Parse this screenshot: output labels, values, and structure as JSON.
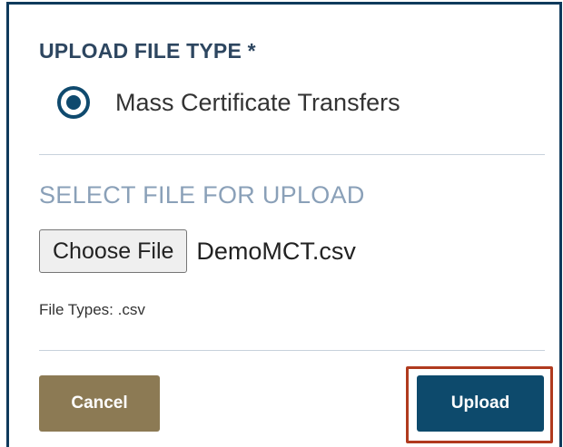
{
  "upload_file_type": {
    "title": "UPLOAD FILE TYPE *",
    "options": [
      {
        "label": "Mass Certificate Transfers",
        "selected": true
      }
    ]
  },
  "file_select": {
    "title": "SELECT FILE FOR UPLOAD",
    "choose_button_label": "Choose File",
    "selected_file_name": "DemoMCT.csv",
    "file_types_hint": "File Types: .csv"
  },
  "actions": {
    "cancel_label": "Cancel",
    "upload_label": "Upload",
    "upload_highlighted": true
  },
  "colors": {
    "panel_border": "#0f3a5c",
    "title_text": "#2d4660",
    "radio_accent": "#0f4a6e",
    "select_title_text": "#8aa0b8",
    "cancel_bg": "#8c7a54",
    "upload_bg": "#0d4a6c",
    "highlight_border": "#b03a1e"
  },
  "icons": {
    "radio": "radio-selected-icon"
  }
}
